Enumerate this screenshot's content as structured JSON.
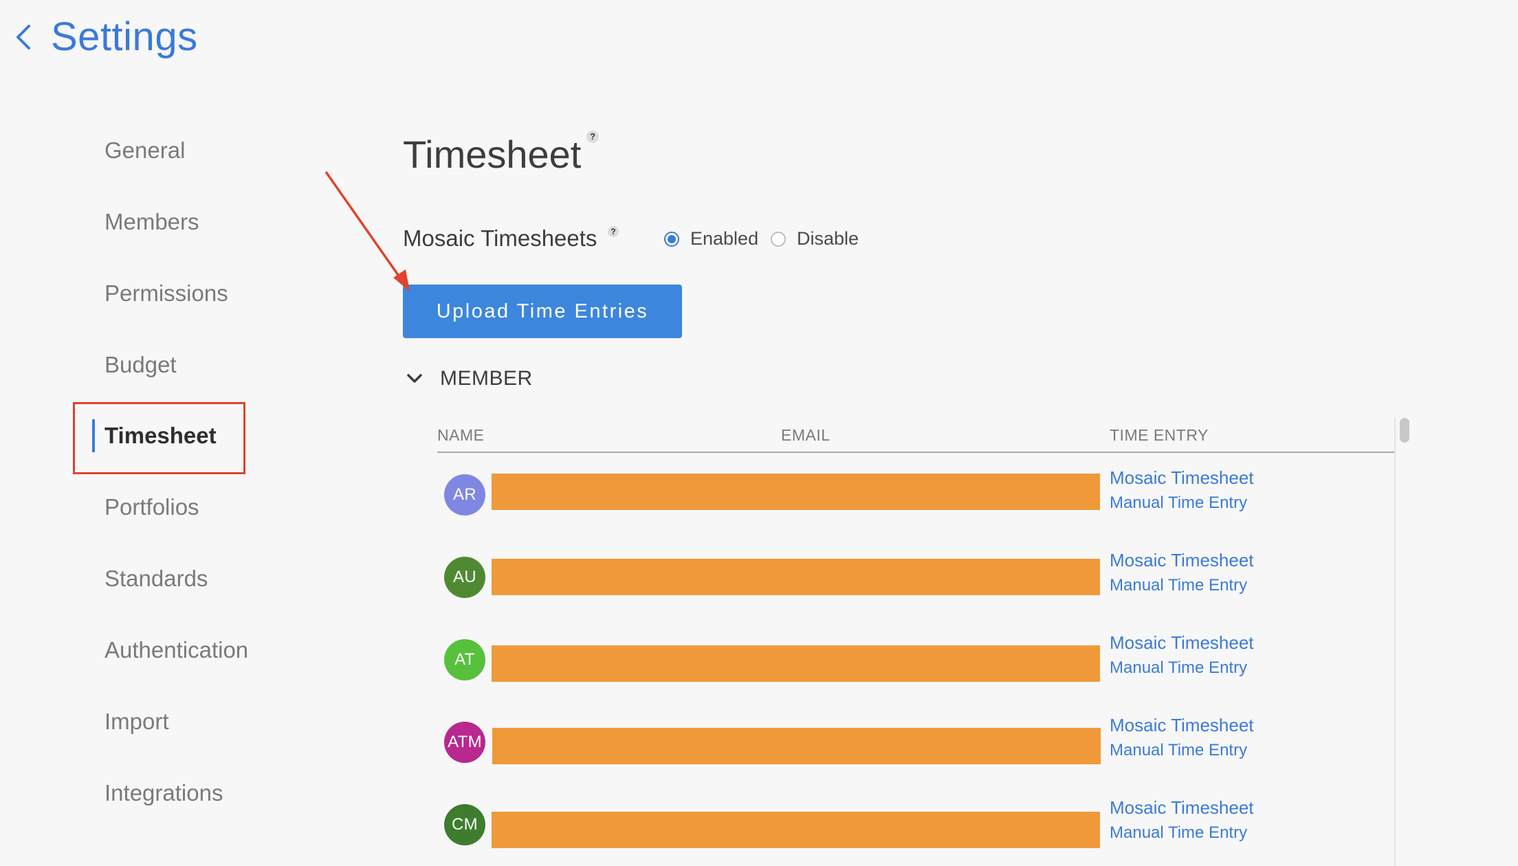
{
  "header": {
    "title": "Settings"
  },
  "sidebar": {
    "items": [
      {
        "label": "General"
      },
      {
        "label": "Members"
      },
      {
        "label": "Permissions"
      },
      {
        "label": "Budget"
      },
      {
        "label": "Timesheet"
      },
      {
        "label": "Portfolios"
      },
      {
        "label": "Standards"
      },
      {
        "label": "Authentication"
      },
      {
        "label": "Import"
      },
      {
        "label": "Integrations"
      }
    ],
    "active": "Timesheet"
  },
  "main": {
    "title": "Timesheet",
    "help_glyph": "?",
    "setting": {
      "label": "Mosaic Timesheets",
      "options": [
        {
          "label": "Enabled",
          "checked": true
        },
        {
          "label": "Disable",
          "checked": false
        }
      ]
    },
    "upload_button": "Upload Time Entries",
    "section": {
      "label": "MEMBER",
      "columns": {
        "name": "NAME",
        "email": "EMAIL",
        "time_entry": "TIME ENTRY"
      },
      "members": [
        {
          "initials": "AR",
          "color": "#7f87e2",
          "links": [
            "Mosaic Timesheet",
            "Manual Time Entry"
          ]
        },
        {
          "initials": "AU",
          "color": "#4f8a33",
          "links": [
            "Mosaic Timesheet",
            "Manual Time Entry"
          ]
        },
        {
          "initials": "AT",
          "color": "#58c13c",
          "links": [
            "Mosaic Timesheet",
            "Manual Time Entry"
          ]
        },
        {
          "initials": "ATM",
          "color": "#b8288f",
          "links": [
            "Mosaic Timesheet",
            "Manual Time Entry"
          ]
        },
        {
          "initials": "CM",
          "color": "#3e7d2e",
          "links": [
            "Mosaic Timesheet",
            "Manual Time Entry"
          ]
        }
      ]
    }
  },
  "colors": {
    "accent": "#3b7ad9",
    "button": "#3d86dd",
    "redaction": "#f0993a",
    "annotation": "#e0432e"
  }
}
